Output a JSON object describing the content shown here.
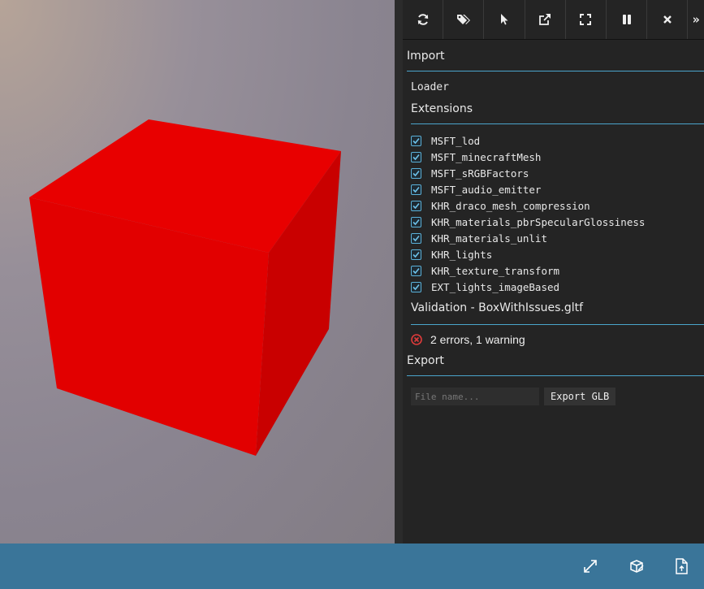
{
  "viewport": {
    "object": "red-cube",
    "cube_color": "#e00000",
    "background": "#8e8792"
  },
  "toolbar": {
    "buttons": [
      {
        "name": "refresh-icon"
      },
      {
        "name": "tags-icon"
      },
      {
        "name": "cursor-icon"
      },
      {
        "name": "external-link-icon"
      },
      {
        "name": "fullscreen-icon"
      },
      {
        "name": "pause-icon"
      },
      {
        "name": "close-icon"
      }
    ],
    "more": "»"
  },
  "import": {
    "title": "Import",
    "loader_label": "Loader",
    "extensions_title": "Extensions",
    "extensions": [
      {
        "label": "MSFT_lod",
        "checked": true
      },
      {
        "label": "MSFT_minecraftMesh",
        "checked": true
      },
      {
        "label": "MSFT_sRGBFactors",
        "checked": true
      },
      {
        "label": "MSFT_audio_emitter",
        "checked": true
      },
      {
        "label": "KHR_draco_mesh_compression",
        "checked": true
      },
      {
        "label": "KHR_materials_pbrSpecularGlossiness",
        "checked": true
      },
      {
        "label": "KHR_materials_unlit",
        "checked": true
      },
      {
        "label": "KHR_lights",
        "checked": true
      },
      {
        "label": "KHR_texture_transform",
        "checked": true
      },
      {
        "label": "EXT_lights_imageBased",
        "checked": true
      }
    ]
  },
  "validation": {
    "title": "Validation - BoxWithIssues.gltf",
    "status": "2 errors, 1 warning",
    "status_color": "#e03b3b"
  },
  "export": {
    "title": "Export",
    "filename_placeholder": "File name...",
    "button_label": "Export GLB"
  },
  "bottombar": {
    "color": "#3a7599",
    "buttons": [
      "fullscreen-expand-icon",
      "inspector-icon",
      "file-upload-icon"
    ]
  },
  "accent": "#4aa5cc"
}
